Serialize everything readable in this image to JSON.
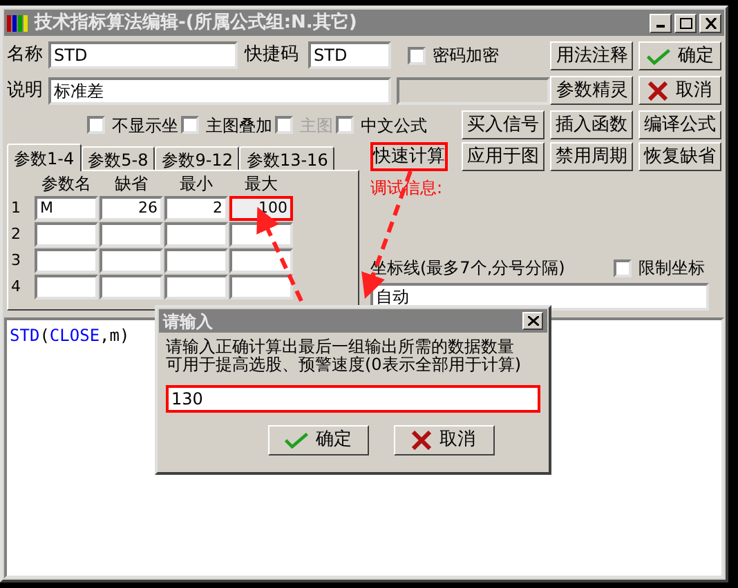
{
  "window": {
    "title": "技术指标算法编辑-(所属公式组:N.其它)"
  },
  "name_field": {
    "label": "名称",
    "value": "STD"
  },
  "shortcut_field": {
    "label": "快捷码",
    "value": "STD"
  },
  "password_checkbox": {
    "label": "密码加密",
    "checked": false
  },
  "description_field": {
    "label": "说明",
    "value": "标准差"
  },
  "side_buttons": [
    {
      "label": "用法注释",
      "kind": "plain"
    },
    {
      "label": "确定",
      "kind": "ok"
    },
    {
      "label": "参数精灵",
      "kind": "plain"
    },
    {
      "label": "取消",
      "kind": "cancel"
    }
  ],
  "options": [
    {
      "label": "不显示坐",
      "checked": false,
      "disabled": false
    },
    {
      "label": "主图叠加",
      "checked": false,
      "disabled": false
    },
    {
      "label": "主图",
      "checked": false,
      "disabled": true
    },
    {
      "label": "中文公式",
      "checked": false,
      "disabled": false
    }
  ],
  "action_buttons": [
    {
      "label": "买入信号",
      "highlighted": false
    },
    {
      "label": "插入函数",
      "highlighted": false
    },
    {
      "label": "编译公式",
      "highlighted": false
    }
  ],
  "tabs": [
    {
      "label": "参数1-4",
      "selected": true
    },
    {
      "label": "参数5-8",
      "selected": false
    },
    {
      "label": "参数9-12",
      "selected": false
    },
    {
      "label": "参数13-16",
      "selected": false
    }
  ],
  "param_table": {
    "columns": [
      "参数名",
      "缺省",
      "最小",
      "最大"
    ],
    "rows": [
      {
        "index": "1",
        "cells": [
          {
            "value": "M",
            "highlighted": false
          },
          {
            "value": "26",
            "highlighted": false
          },
          {
            "value": "2",
            "highlighted": false
          },
          {
            "value": "100",
            "highlighted": true
          }
        ]
      },
      {
        "index": "2",
        "cells": []
      },
      {
        "index": "3",
        "cells": []
      },
      {
        "index": "4",
        "cells": []
      }
    ]
  },
  "calc_buttons": [
    {
      "label": "快速计算",
      "highlighted": true
    },
    {
      "label": "应用于图",
      "highlighted": false
    },
    {
      "label": "禁用周期",
      "highlighted": false
    },
    {
      "label": "恢复缺省",
      "highlighted": false
    }
  ],
  "debug_label": "调试信息:",
  "axis_lines": {
    "label": "坐标线(最多7个,分号分隔)",
    "value": "自动"
  },
  "limit_checkbox": {
    "label": "限制坐标",
    "checked": false
  },
  "editor": {
    "tokens": [
      {
        "text": "STD",
        "kind": "function"
      },
      {
        "text": "(",
        "kind": "plain"
      },
      {
        "text": "CLOSE",
        "kind": "function"
      },
      {
        "text": ",m)",
        "kind": "plain"
      }
    ]
  },
  "input_dialog": {
    "title": "请输入",
    "message": [
      "请输入正确计算出最后一组输出所需的数据数量",
      "可用于提高选股、预警速度(0表示全部用于计算)"
    ],
    "value": "130",
    "highlighted": true,
    "buttons": [
      {
        "label": "确定",
        "kind": "ok"
      },
      {
        "label": "取消",
        "kind": "cancel"
      }
    ]
  }
}
